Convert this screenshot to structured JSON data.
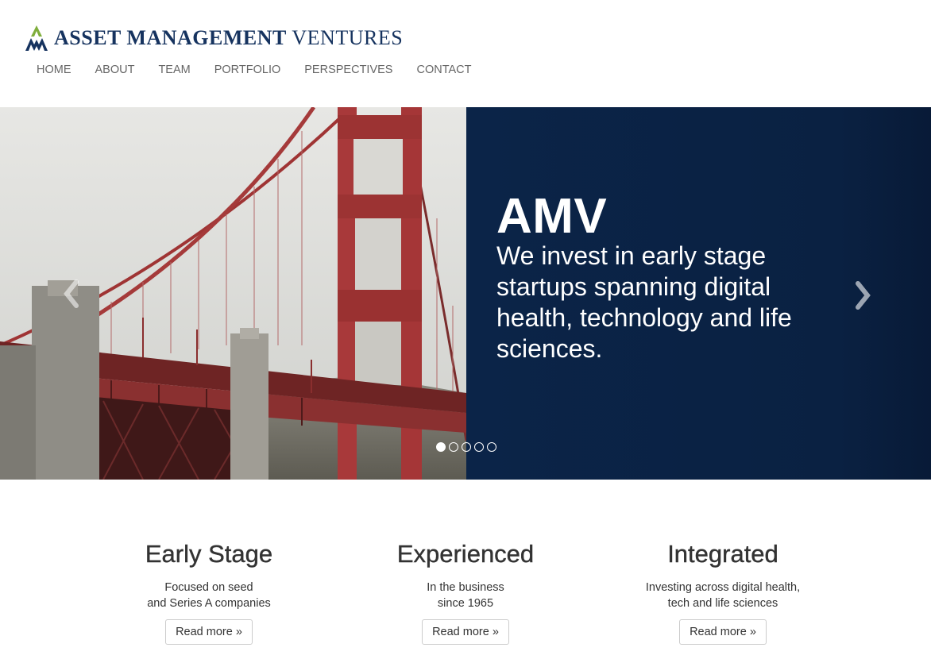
{
  "brand": {
    "name_bold": "ASSET MANAGEMENT",
    "name_regular": "VENTURES",
    "logo_icon": "amv-mountain-logo",
    "colors": {
      "navy": "#16335f",
      "green": "#7fae3c"
    }
  },
  "nav": {
    "items": [
      {
        "label": "HOME"
      },
      {
        "label": "ABOUT"
      },
      {
        "label": "TEAM"
      },
      {
        "label": "PORTFOLIO"
      },
      {
        "label": "PERSPECTIVES"
      },
      {
        "label": "CONTACT"
      }
    ]
  },
  "hero": {
    "title": "AMV",
    "text": "We invest in early stage startups spanning digital health, technology and life sciences.",
    "panel_color": "#0b2448",
    "prev_icon": "chevron-left-icon",
    "next_icon": "chevron-right-icon",
    "slides_total": 5,
    "active_slide": 1
  },
  "features": [
    {
      "title": "Early Stage",
      "line1": "Focused on seed",
      "line2": "and Series A companies",
      "button": "Read more »"
    },
    {
      "title": "Experienced",
      "line1": "In the business",
      "line2": "since 1965",
      "button": "Read more »"
    },
    {
      "title": "Integrated",
      "line1": "Investing across digital health,",
      "line2": "tech and life sciences",
      "button": "Read more »"
    }
  ]
}
